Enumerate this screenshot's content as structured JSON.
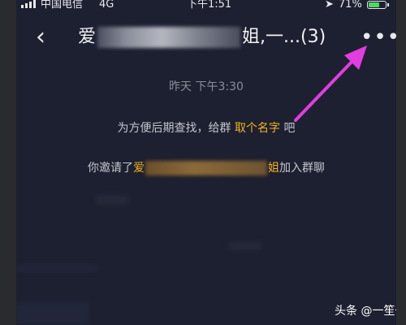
{
  "status_bar": {
    "carrier": "中国电信",
    "network": "4G",
    "time": "下午1:51",
    "battery_percent": "71%",
    "battery_level": 0.71,
    "icons": [
      "signal-bars-icon",
      "location-arrow-icon",
      "battery-icon"
    ]
  },
  "nav": {
    "back_icon": "chevron-left-icon",
    "title_prefix": "爱",
    "title_suffix": "姐,一...(3)",
    "more_icon": "more-dots-icon"
  },
  "chat": {
    "timestamp": "昨天 下午3:30",
    "system_message_1": {
      "text": "为方便后期查找，给群",
      "link": "取个名字",
      "suffix": "吧"
    },
    "system_message_2": {
      "prefix": "你邀请了",
      "name_start": "爱",
      "name_end": "姐",
      "suffix": "加入群聊"
    }
  },
  "watermark": "头条 @一笙一墨",
  "colors": {
    "background": "#1d2030",
    "link": "#f5b41e",
    "annotation_arrow": "#e23de0",
    "battery": "#4cd964"
  }
}
